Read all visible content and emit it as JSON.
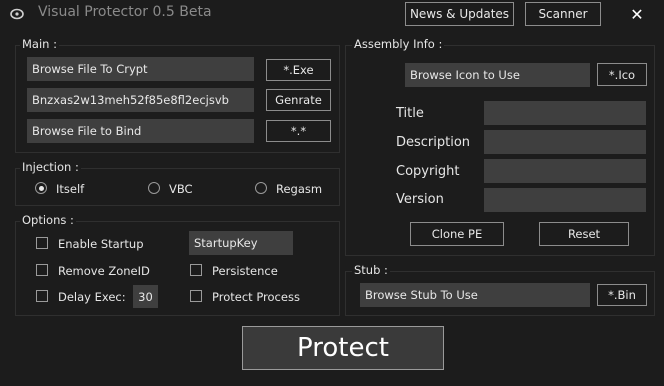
{
  "window": {
    "title": "Visual Protector 0.5 Beta",
    "close_glyph": "✕"
  },
  "header": {
    "news_label": "News & Updates",
    "scanner_label": "Scanner"
  },
  "main": {
    "group_label": "Main :",
    "crypt_field": "Browse File To Crypt",
    "crypt_btn": "*.Exe",
    "key_field": "Bnzxas2w13meh52f85e8fl2ecjsvb",
    "key_btn": "Genrate",
    "bind_field": "Browse File to Bind",
    "bind_btn": "*.*"
  },
  "injection": {
    "group_label": "Injection :",
    "options": [
      "Itself",
      "VBC",
      "Regasm"
    ],
    "selected": "Itself"
  },
  "options": {
    "group_label": "Options :",
    "enable_startup": "Enable Startup",
    "startup_key": "StartupKey",
    "remove_zone": "Remove ZoneID",
    "persistence": "Persistence",
    "delay_exec": "Delay Exec:",
    "delay_value": "30",
    "protect_process": "Protect Process"
  },
  "assembly": {
    "group_label": "Assembly Info :",
    "icon_field": "Browse Icon to Use",
    "icon_btn": "*.Ico",
    "title_label": "Title",
    "description_label": "Description",
    "copyright_label": "Copyright",
    "version_label": "Version",
    "clone_label": "Clone PE",
    "reset_label": "Reset"
  },
  "stub": {
    "group_label": "Stub :",
    "stub_field": "Browse Stub To Use",
    "stub_btn": "*.Bin"
  },
  "protect_label": "Protect"
}
